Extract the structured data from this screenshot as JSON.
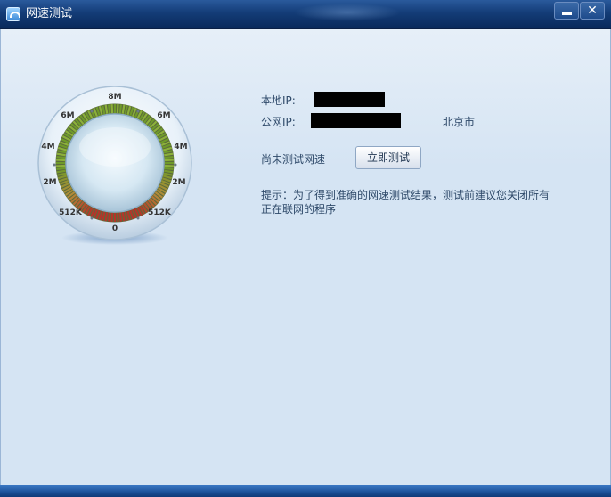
{
  "window": {
    "title": "网速测试",
    "minimize_icon": "minimize-icon",
    "close_label": "✕"
  },
  "gauge": {
    "ticks": [
      "8M",
      "6M",
      "6M",
      "4M",
      "4M",
      "2M",
      "2M",
      "512K",
      "512K",
      "0"
    ],
    "ring_colors": {
      "high": "#6f9a2a",
      "mid": "#b48a3a",
      "low": "#b3352a"
    }
  },
  "info": {
    "local_ip_label": "本地IP:",
    "public_ip_label": "公网IP:",
    "location": "北京市"
  },
  "status": {
    "text": "尚未测试网速",
    "test_button": "立即测试"
  },
  "tip": {
    "text": "提示：为了得到准确的网速测试结果，测试前建议您关闭所有正在联网的程序"
  }
}
